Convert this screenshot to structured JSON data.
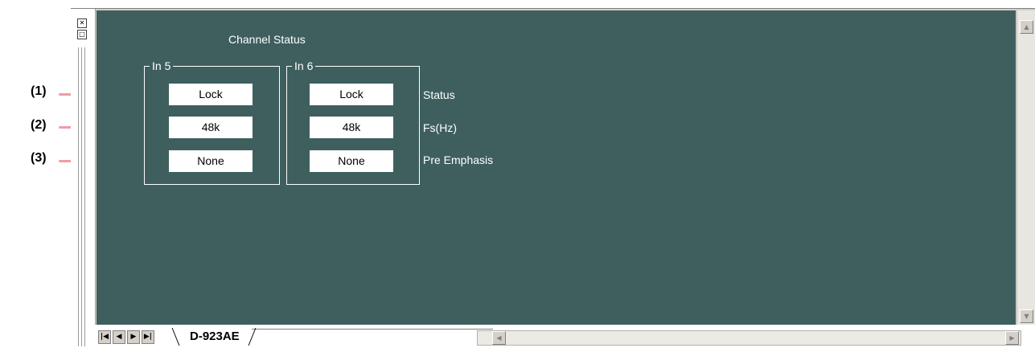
{
  "callouts": [
    "(1)",
    "(2)",
    "(3)"
  ],
  "panel": {
    "title": "Channel Status",
    "groups": [
      {
        "label": "In 5",
        "status": "Lock",
        "fs": "48k",
        "pre_emphasis": "None"
      },
      {
        "label": "In 6",
        "status": "Lock",
        "fs": "48k",
        "pre_emphasis": "None"
      }
    ],
    "row_labels": {
      "status": "Status",
      "fs": "Fs(Hz)",
      "pre_emphasis": "Pre Emphasis"
    }
  },
  "sheet_tab": "D-923AE",
  "icons": {
    "close": "close-icon",
    "restore": "restore-icon",
    "nav": [
      "first-sheet-icon",
      "prev-sheet-icon",
      "next-sheet-icon",
      "last-sheet-icon"
    ],
    "scroll": [
      "scroll-up-icon",
      "scroll-down-icon",
      "scroll-left-icon",
      "scroll-right-icon"
    ]
  },
  "colors": {
    "panel_background": "#3f5f5f",
    "callout_line": "#f29ba5",
    "panel_text": "#ffffff"
  }
}
